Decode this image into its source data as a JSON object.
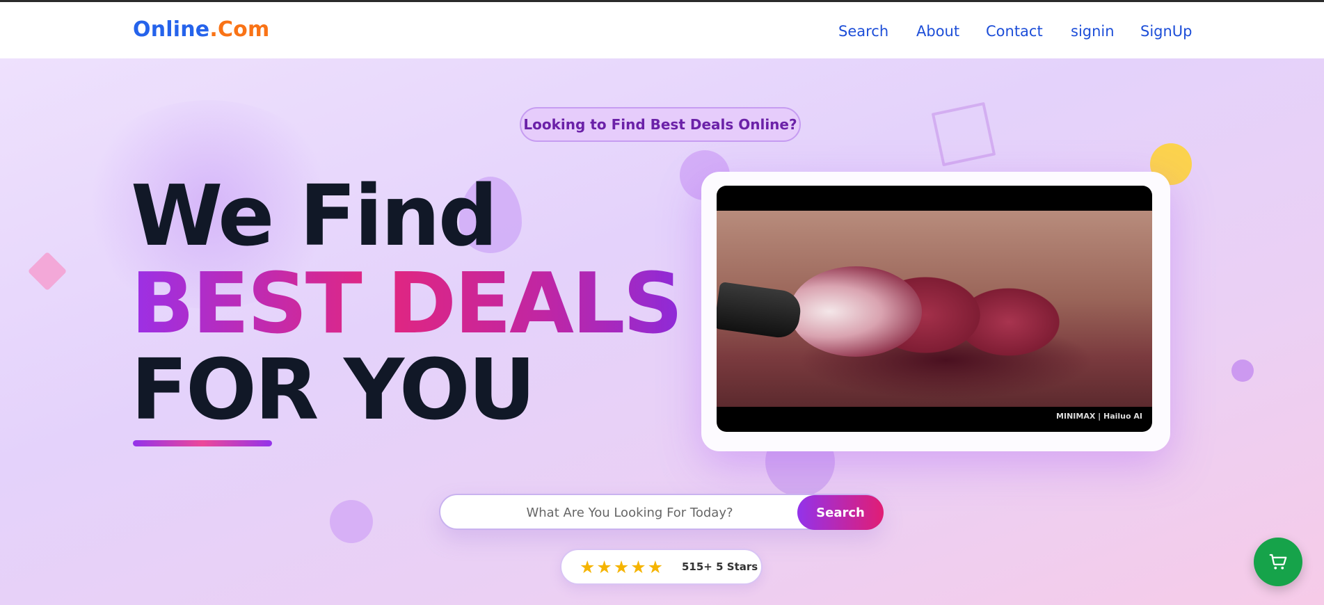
{
  "logo": {
    "part1": "Online",
    "part2": ".Com"
  },
  "nav": {
    "items": [
      {
        "label": "Search"
      },
      {
        "label": "About"
      },
      {
        "label": "Contact"
      },
      {
        "label": "signin"
      },
      {
        "label": "SignUp"
      }
    ]
  },
  "hero": {
    "pill": "Looking to Find Best Deals Online?",
    "line1": "We Find",
    "line2": "BEST DEALS",
    "line3": "FOR YOU"
  },
  "video": {
    "watermark": "MINIMAX | Hailuo AI"
  },
  "search": {
    "placeholder": "What Are You Looking For Today?",
    "button": "Search"
  },
  "rating": {
    "stars": "★★★★★",
    "star_count": 5,
    "text": "515+ 5 Stars"
  },
  "colors": {
    "logo_blue": "#2563eb",
    "logo_orange": "#f97316",
    "accent_purple": "#9333ea",
    "accent_pink": "#e11d74",
    "cart_green": "#16a34a"
  },
  "icons": {
    "cart": "shopping-cart-icon",
    "star": "star-icon"
  }
}
